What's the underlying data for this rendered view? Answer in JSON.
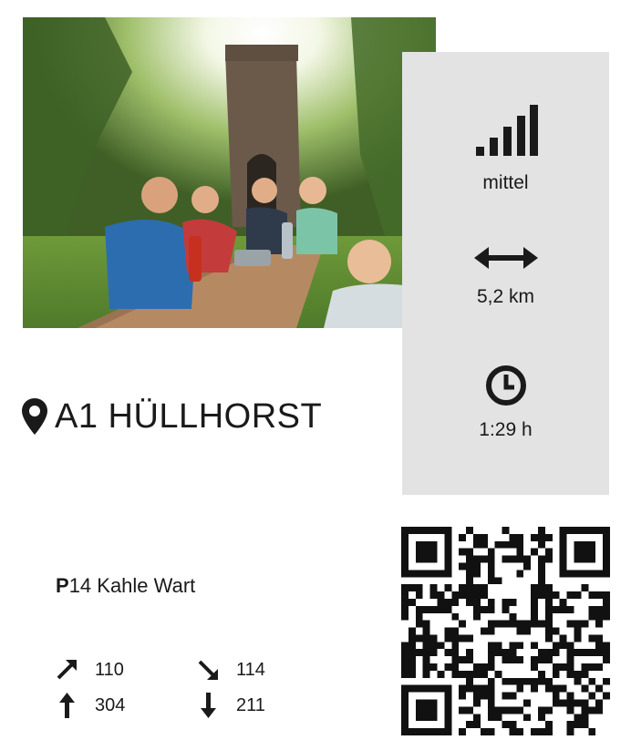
{
  "difficulty": {
    "label": "mittel",
    "icon": "signal-bars-icon"
  },
  "distance": {
    "label": "5,2 km",
    "icon": "double-arrow-icon"
  },
  "duration": {
    "label": "1:29 h",
    "icon": "clock-icon"
  },
  "title": {
    "text": "A1 HÜLLHORST",
    "icon": "map-pin-icon"
  },
  "parking": {
    "prefix": "P",
    "text": "14 Kahle Wart"
  },
  "elevation": {
    "ascent_diag": "110",
    "descent_diag": "114",
    "ascent": "304",
    "descent": "211"
  },
  "colors": {
    "panel": "#e3e3e3",
    "text": "#1a1a1a"
  }
}
